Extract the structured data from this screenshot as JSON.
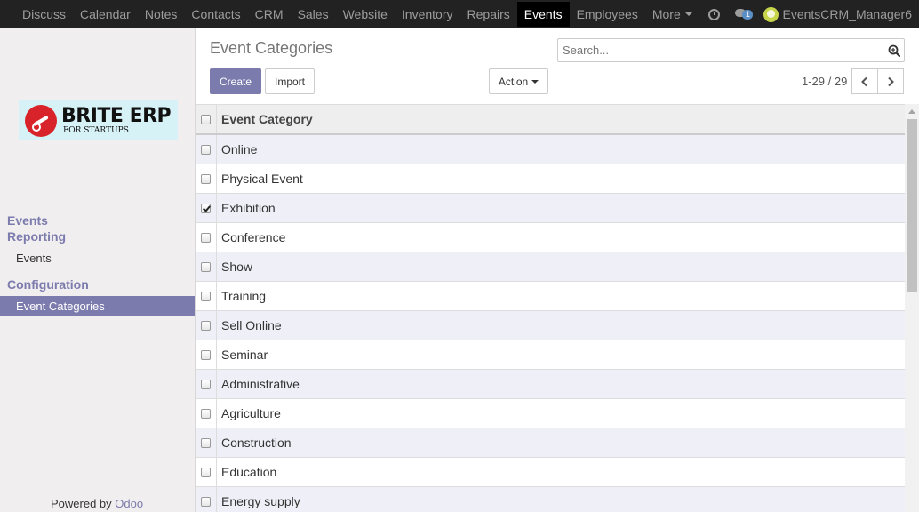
{
  "navbar": {
    "items": [
      {
        "label": "Discuss"
      },
      {
        "label": "Calendar"
      },
      {
        "label": "Notes"
      },
      {
        "label": "Contacts"
      },
      {
        "label": "CRM"
      },
      {
        "label": "Sales"
      },
      {
        "label": "Website"
      },
      {
        "label": "Inventory"
      },
      {
        "label": "Repairs"
      },
      {
        "label": "Events"
      },
      {
        "label": "Employees"
      },
      {
        "label": "More"
      }
    ],
    "active": "Events",
    "chat_badge": "1",
    "user_name": "EventsCRM_Manager6",
    "icons": [
      "clock-icon",
      "chat-icon",
      "avatar"
    ]
  },
  "sidebar": {
    "logo": {
      "brand": "BRITE ERP",
      "tagline": "FOR STARTUPS",
      "brand_color": "#d8232a"
    },
    "sections": {
      "events": "Events",
      "reporting": "Reporting",
      "reporting_events": "Events",
      "configuration": "Configuration",
      "event_categories": "Event Categories"
    },
    "powered_by": "Powered by",
    "powered_brand": "Odoo"
  },
  "control_panel": {
    "title": "Event Categories",
    "search_placeholder": "Search...",
    "create_label": "Create",
    "import_label": "Import",
    "action_label": "Action",
    "pager": "1-29 / 29"
  },
  "list": {
    "header": "Event Category",
    "rows": [
      {
        "label": "Online",
        "checked": false
      },
      {
        "label": "Physical Event",
        "checked": false
      },
      {
        "label": "Exhibition",
        "checked": true
      },
      {
        "label": "Conference",
        "checked": false
      },
      {
        "label": "Show",
        "checked": false
      },
      {
        "label": "Training",
        "checked": false
      },
      {
        "label": "Sell Online",
        "checked": false
      },
      {
        "label": "Seminar",
        "checked": false
      },
      {
        "label": "Administrative",
        "checked": false
      },
      {
        "label": "Agriculture",
        "checked": false
      },
      {
        "label": "Construction",
        "checked": false
      },
      {
        "label": "Education",
        "checked": false
      },
      {
        "label": "Energy supply",
        "checked": false
      }
    ]
  },
  "colors": {
    "accent": "#7c7bad",
    "navbar_bg": "#222222",
    "odd_row": "#efeff7"
  }
}
